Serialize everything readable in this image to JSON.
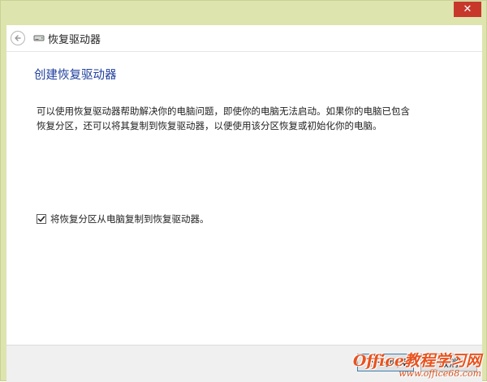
{
  "window": {
    "close_symbol": "✕",
    "close_color": "#c7382b",
    "frame_color": "#dee4ad"
  },
  "header": {
    "back_icon": "back-arrow-icon",
    "drive_icon": "drive-icon",
    "title": "恢复驱动器"
  },
  "main": {
    "page_title": "创建恢复驱动器",
    "title_color": "#1e3e9e",
    "description": "可以使用恢复驱动器帮助解决你的电脑问题，即使你的电脑无法启动。如果你的电脑已包含恢复分区，还可以将其复制到恢复驱动器，以便使用该分区恢复或初始化你的电脑。",
    "checkbox": {
      "checked": true,
      "label": "将恢复分区从电脑复制到恢复驱动器。"
    }
  },
  "footer": {
    "next_label": "下一步(N)",
    "cancel_label": "取消"
  },
  "watermark": {
    "brand": "Office教程学习网",
    "url": "www.office68.com"
  }
}
